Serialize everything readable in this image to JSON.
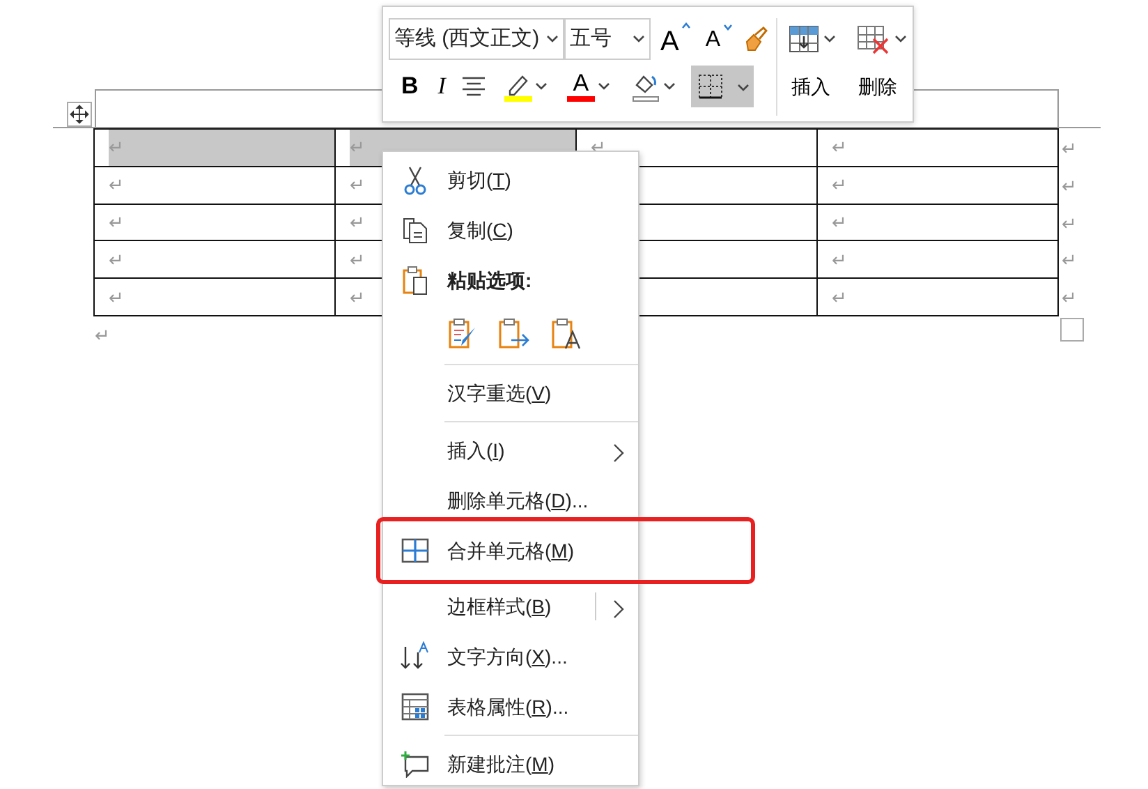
{
  "toolbar": {
    "font_name": "等线 (西文正文)",
    "font_size": "五号",
    "grow_font": "A",
    "shrink_font": "A",
    "bold": "B",
    "italic": "I",
    "font_color": "A",
    "borders_pressed": true,
    "insert_label": "插入",
    "delete_label": "删除"
  },
  "table": {
    "rows": [
      {
        "cells": [
          {
            "mark": "↵",
            "selected": true
          },
          {
            "mark": "↵",
            "selected": true
          },
          {
            "mark": "↵",
            "selected": false
          },
          {
            "mark": "↵",
            "selected": false
          }
        ],
        "end_mark": "↵"
      },
      {
        "cells": [
          {
            "mark": "↵",
            "selected": false
          },
          {
            "mark": "↵",
            "selected": false
          },
          {
            "selected": false
          },
          {
            "mark": "↵",
            "selected": false
          }
        ],
        "end_mark": "↵"
      },
      {
        "cells": [
          {
            "mark": "↵",
            "selected": false
          },
          {
            "mark": "↵",
            "selected": false
          },
          {
            "selected": false
          },
          {
            "mark": "↵",
            "selected": false
          }
        ],
        "end_mark": "↵"
      },
      {
        "cells": [
          {
            "mark": "↵",
            "selected": false
          },
          {
            "mark": "↵",
            "selected": false
          },
          {
            "selected": false
          },
          {
            "mark": "↵",
            "selected": false
          }
        ],
        "end_mark": "↵"
      },
      {
        "cells": [
          {
            "mark": "↵",
            "selected": false
          },
          {
            "mark": "↵",
            "selected": false
          },
          {
            "selected": false
          },
          {
            "mark": "↵",
            "selected": false
          }
        ],
        "end_mark": "↵"
      }
    ],
    "after_mark": "↵"
  },
  "context_menu": {
    "items": [
      {
        "kind": "command",
        "before": "剪切(",
        "key": "T",
        "after": ")"
      },
      {
        "kind": "command",
        "before": "复制(",
        "key": "C",
        "after": ")"
      },
      {
        "kind": "heading",
        "text": "粘贴选项:"
      },
      {
        "kind": "paste_options"
      },
      {
        "kind": "separator"
      },
      {
        "kind": "command",
        "before": "汉字重选(",
        "key": "V",
        "after": ")"
      },
      {
        "kind": "separator"
      },
      {
        "kind": "command",
        "before": "插入(",
        "key": "I",
        "after": ")",
        "submenu": true
      },
      {
        "kind": "command",
        "before": "删除单元格(",
        "key": "D",
        "after": ")..."
      },
      {
        "kind": "command",
        "before": "合并单元格(",
        "key": "M",
        "after": ")",
        "highlighted": true
      },
      {
        "kind": "command",
        "before": "边框样式(",
        "key": "B",
        "after": ")",
        "submenu": true,
        "split_arrow": true
      },
      {
        "kind": "command",
        "before": "文字方向(",
        "key": "X",
        "after": ")..."
      },
      {
        "kind": "command",
        "before": "表格属性(",
        "key": "R",
        "after": ")..."
      },
      {
        "kind": "separator"
      },
      {
        "kind": "command",
        "before": "新建批注(",
        "key": "M",
        "after": ")"
      }
    ]
  }
}
